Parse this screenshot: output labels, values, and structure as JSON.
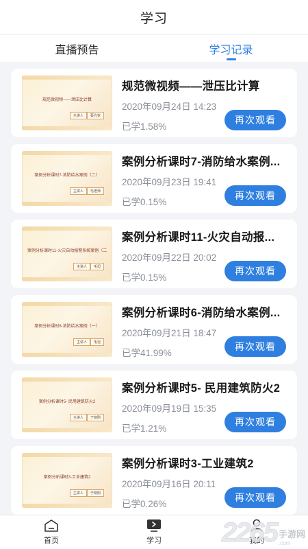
{
  "header": {
    "title": "学习"
  },
  "tabs": [
    {
      "label": "直播预告",
      "active": false
    },
    {
      "label": "学习记录",
      "active": true
    }
  ],
  "records": [
    {
      "thumb_title": "规范微视频——泄压比计算",
      "thumb_tag": [
        "主讲人",
        "蔡光钦"
      ],
      "title": "规范微视频——泄压比计算",
      "time": "2020年09月24日 14:23",
      "progress": "已学1.58%",
      "button": "再次观看"
    },
    {
      "thumb_title": "案例分析课时7-消防给水案例（二）",
      "thumb_tag": [
        "主讲人",
        "毛老师"
      ],
      "title": "案例分析课时7-消防给水案例...",
      "time": "2020年09月23日 19:41",
      "progress": "已学0.15%",
      "button": "再次观看"
    },
    {
      "thumb_title": "案例分析课时11-火灾自动报警系统案例（二）",
      "thumb_tag": [
        "主讲人",
        "毛坦"
      ],
      "title": "案例分析课时11-火灾自动报...",
      "time": "2020年09月22日 20:02",
      "progress": "已学0.15%",
      "button": "再次观看"
    },
    {
      "thumb_title": "案例分析课时6-消防给水案例（一）",
      "thumb_tag": [
        "主讲人",
        "毛坦"
      ],
      "title": "案例分析课时6-消防给水案例...",
      "time": "2020年09月21日 18:47",
      "progress": "已学41.99%",
      "button": "再次观看"
    },
    {
      "thumb_title": "案例分析课时5- 民用建筑防火2",
      "thumb_tag": [
        "主讲人",
        "于晓刚"
      ],
      "title": "案例分析课时5- 民用建筑防火2",
      "time": "2020年09月19日 15:35",
      "progress": "已学1.21%",
      "button": "再次观看"
    },
    {
      "thumb_title": "案例分析课时3-工业建筑2",
      "thumb_tag": [
        "主讲人",
        "于晓刚"
      ],
      "title": "案例分析课时3-工业建筑2",
      "time": "2020年09月16日 20:11",
      "progress": "已学0.26%",
      "button": "再次观看"
    }
  ],
  "bottom_nav": [
    {
      "label": "首页",
      "icon": "home-icon"
    },
    {
      "label": "学习",
      "icon": "play-screen-icon"
    },
    {
      "label": "我的",
      "icon": "user-icon"
    }
  ],
  "watermark": {
    "number": "2265",
    "text": "手游网",
    "url": ".com"
  },
  "colors": {
    "accent": "#2f7fe0",
    "background": "#f3f4f7"
  }
}
